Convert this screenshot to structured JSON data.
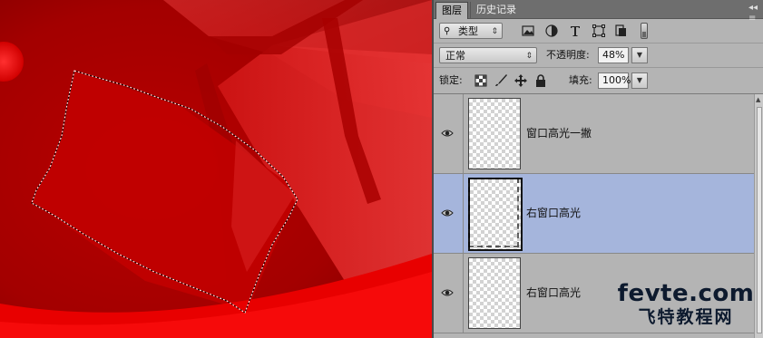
{
  "panel": {
    "tabs": [
      {
        "label": "图层",
        "active": true
      },
      {
        "label": "历史记录",
        "active": false
      }
    ],
    "menu_icon": "panel-menu-icon"
  },
  "filter": {
    "kind_label": "类型",
    "icons": [
      "pixel-filter-icon",
      "adjustment-filter-icon",
      "type-filter-icon",
      "shape-filter-icon",
      "smart-object-filter-icon",
      "filter-toggle-icon"
    ]
  },
  "blend": {
    "mode": "正常",
    "opacity_label": "不透明度:",
    "opacity_value": "48%"
  },
  "lock": {
    "label": "锁定:",
    "icons": [
      "lock-transparent-icon",
      "lock-image-icon",
      "lock-position-icon",
      "lock-all-icon"
    ],
    "fill_label": "填充:",
    "fill_value": "100%"
  },
  "layers": [
    {
      "name": "窗口高光一撇",
      "visible": true,
      "selected": false
    },
    {
      "name": "右窗口高光",
      "visible": true,
      "selected": true
    },
    {
      "name": "右窗口高光",
      "visible": true,
      "selected": false
    }
  ],
  "watermark": {
    "line1": "fevte.com",
    "line2": "飞特教程网"
  },
  "colors": {
    "canvas_red": "#c00000",
    "selected_layer": "#a5b5dc",
    "panel_bg": "#b4b4b4"
  }
}
